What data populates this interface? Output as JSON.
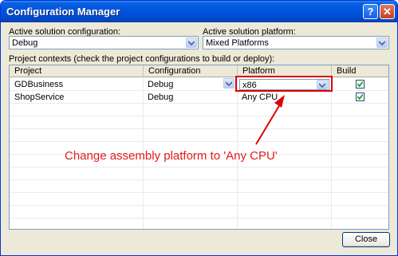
{
  "window": {
    "title": "Configuration Manager",
    "help_icon": "question-mark-icon",
    "close_icon": "close-x-icon"
  },
  "active_config": {
    "label": "Active solution configuration:",
    "value": "Debug"
  },
  "active_platform": {
    "label": "Active solution platform:",
    "value": "Mixed Platforms"
  },
  "contexts": {
    "label": "Project contexts (check the project configurations to build or deploy):",
    "headers": [
      "Project",
      "Configuration",
      "Platform",
      "Build"
    ],
    "rows": [
      {
        "project": "GDBusiness",
        "configuration": "Debug",
        "platform": "x86",
        "build": true
      },
      {
        "project": "ShopService",
        "configuration": "Debug",
        "platform": "Any CPU",
        "build": true
      }
    ]
  },
  "annotation": {
    "text": "Change assembly platform to 'Any CPU'",
    "color": "#e41b1b"
  },
  "footer": {
    "close_label": "Close"
  }
}
